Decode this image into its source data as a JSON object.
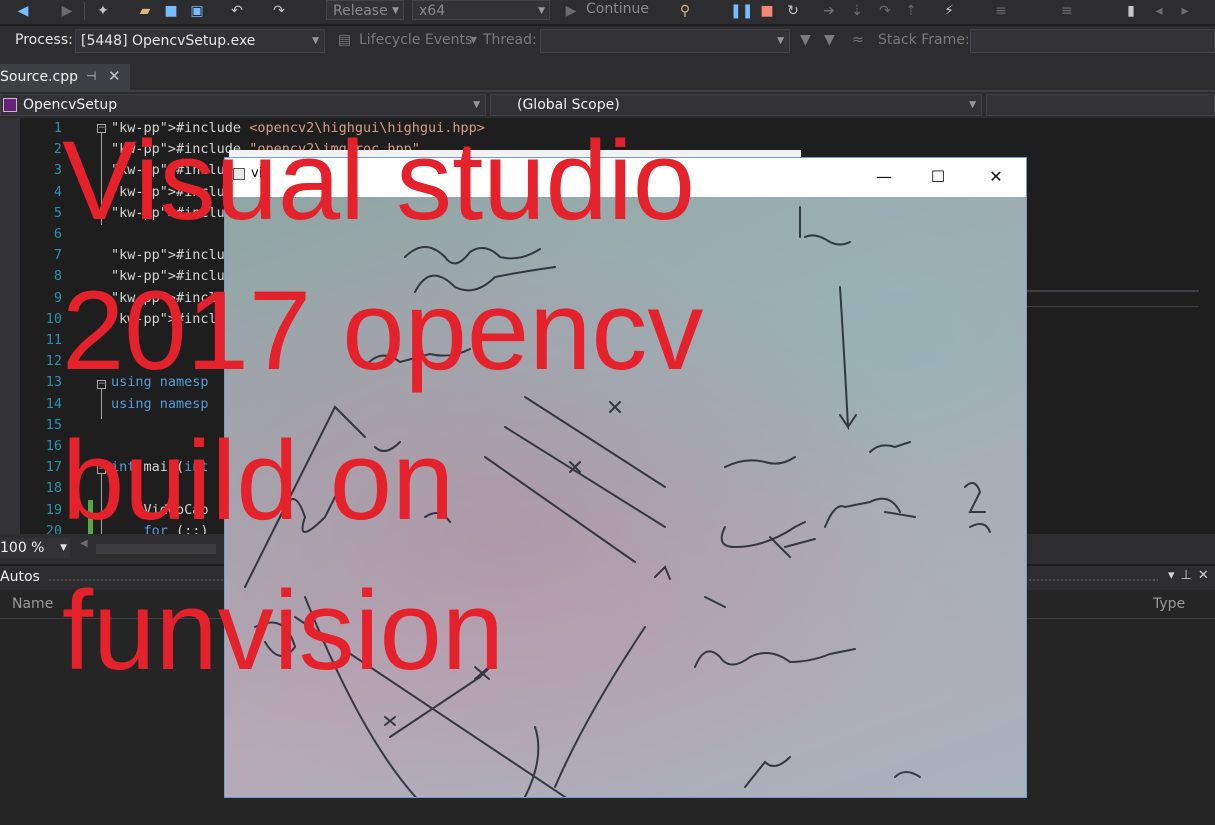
{
  "toolbar": {
    "config": "Release",
    "platform": "x64",
    "continue_label": "Continue"
  },
  "process_bar": {
    "process_label": "Process:",
    "process_value": "[5448] OpencvSetup.exe",
    "lifecycle_label": "Lifecycle Events",
    "thread_label": "Thread:",
    "stack_frame_label": "Stack Frame:"
  },
  "tab": {
    "label": "Source.cpp"
  },
  "nav": {
    "project": "OpencvSetup",
    "scope": "(Global Scope)"
  },
  "code": {
    "lines": [
      {
        "n": "1",
        "text": "#include <opencv2\\highgui\\highgui.hpp>"
      },
      {
        "n": "2",
        "text": "#include \"opencv2\\imgproc.hpp\""
      },
      {
        "n": "3",
        "text": "#include \"op"
      },
      {
        "n": "4",
        "text": "#include \"o"
      },
      {
        "n": "5",
        "text": "#include  op"
      },
      {
        "n": "6",
        "text": ""
      },
      {
        "n": "7",
        "text": "#include <ve"
      },
      {
        "n": "8",
        "text": "#include <st"
      },
      {
        "n": "9",
        "text": "#include <Wi"
      },
      {
        "n": "10",
        "text": "#include <io"
      },
      {
        "n": "11",
        "text": ""
      },
      {
        "n": "12",
        "text": ""
      },
      {
        "n": "13",
        "text": "using namesp"
      },
      {
        "n": "14",
        "text": "using namesp"
      },
      {
        "n": "15",
        "text": ""
      },
      {
        "n": "16",
        "text": ""
      },
      {
        "n": "17",
        "text": "int main(int"
      },
      {
        "n": "18",
        "text": "{"
      },
      {
        "n": "19",
        "text": "    VideoCap"
      },
      {
        "n": "20",
        "text": "    for (;;)"
      }
    ]
  },
  "zoom": {
    "value": "100 %"
  },
  "autos": {
    "title": "Autos",
    "col_name": "Name",
    "col_type": "Type"
  },
  "image_window": {
    "title": "vi",
    "minimize": "—",
    "maximize": "☐",
    "close": "✕"
  },
  "overlay": {
    "caption": "Visual studio\n2017 opencv\nbuild on\nfunvision",
    "color": "#e5212b"
  }
}
